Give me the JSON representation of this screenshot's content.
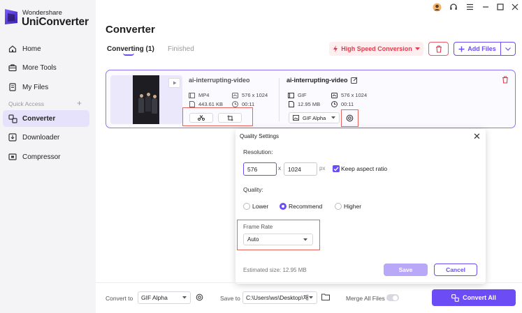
{
  "app": {
    "brand_line1": "Wondershare",
    "brand_line2": "UniConverter"
  },
  "sidebar": {
    "items": [
      {
        "label": "Home",
        "icon": "home-icon"
      },
      {
        "label": "More Tools",
        "icon": "toolbox-icon"
      },
      {
        "label": "My Files",
        "icon": "files-icon"
      },
      {
        "label": "Converter",
        "icon": "converter-icon",
        "active": true
      },
      {
        "label": "Downloader",
        "icon": "download-icon"
      },
      {
        "label": "Compressor",
        "icon": "compress-icon"
      }
    ],
    "quick_access": "Quick Access"
  },
  "header": {
    "title": "Converter",
    "tabs": {
      "converting": "Converting (1)",
      "finished": "Finished"
    },
    "high_speed": "High Speed Conversion",
    "add_files": "Add Files"
  },
  "file": {
    "source": {
      "name": "ai-interrupting-video",
      "format": "MP4",
      "resolution": "576 x 1024",
      "size": "443.61 KB",
      "duration": "00:11"
    },
    "target": {
      "name": "ai-interrupting-video",
      "format": "GIF",
      "resolution": "576 x 1024",
      "size": "12.95 MB",
      "duration": "00:11",
      "preset": "GIF Alpha"
    }
  },
  "quality_panel": {
    "title": "Quality Settings",
    "resolution_label": "Resolution:",
    "width": "576",
    "height": "1024",
    "x_sep": "x",
    "px": "px",
    "keep_aspect": "Keep aspect ratio",
    "quality_label": "Quality:",
    "quality_options": [
      "Lower",
      "Recommend",
      "Higher"
    ],
    "quality_selected": "Recommend",
    "frame_rate_label": "Frame Rate",
    "frame_rate_value": "Auto",
    "estimated": "Estimated size: 12.95 MB",
    "save": "Save",
    "cancel": "Cancel"
  },
  "bottom": {
    "convert_to_label": "Convert to",
    "convert_to_value": "GIF Alpha",
    "save_to_label": "Save to",
    "save_to_value": "C:\\Users\\ws\\Desktop\\채",
    "merge_label": "Merge All Files",
    "convert_all": "Convert All"
  },
  "colors": {
    "accent": "#6b4cf5",
    "danger": "#e5394b",
    "highlight_box": "#e8645a"
  }
}
